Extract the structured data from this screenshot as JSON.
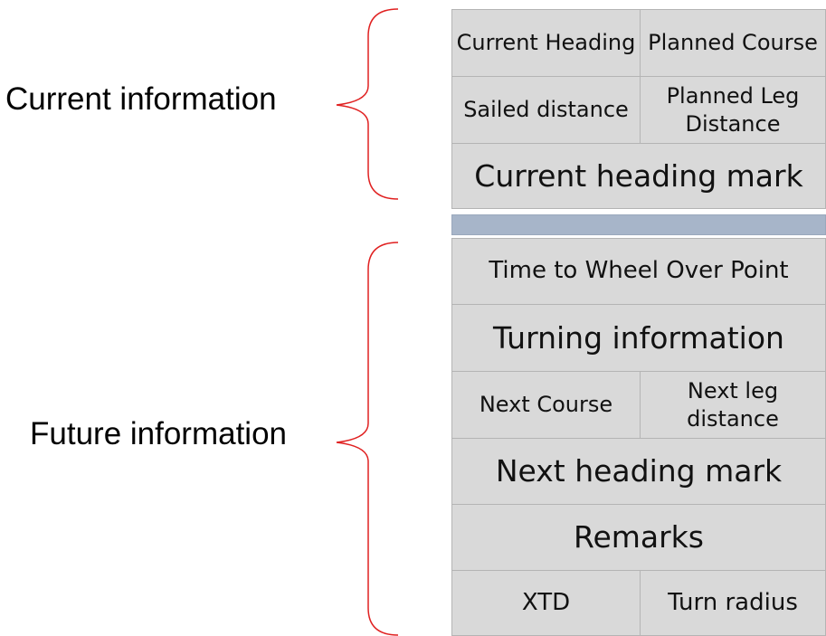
{
  "groups": {
    "current_label": "Current information",
    "future_label": "Future information"
  },
  "panel": {
    "current_heading": "Current Heading",
    "planned_course": "Planned Course",
    "sailed_distance": "Sailed distance",
    "planned_leg_distance": "Planned Leg Distance",
    "current_heading_mark": "Current heading mark",
    "time_to_wheel_over_point": "Time to Wheel Over Point",
    "turning_information": "Turning information",
    "next_course": "Next Course",
    "next_leg_distance": "Next leg distance",
    "next_heading_mark": "Next heading mark",
    "remarks": "Remarks",
    "xtd": "XTD",
    "turn_radius": "Turn radius"
  },
  "colors": {
    "cell_fill": "#d9d9d9",
    "cell_border": "#b4b4b4",
    "separator": "#a7b5c9",
    "brace": "#e02020"
  }
}
